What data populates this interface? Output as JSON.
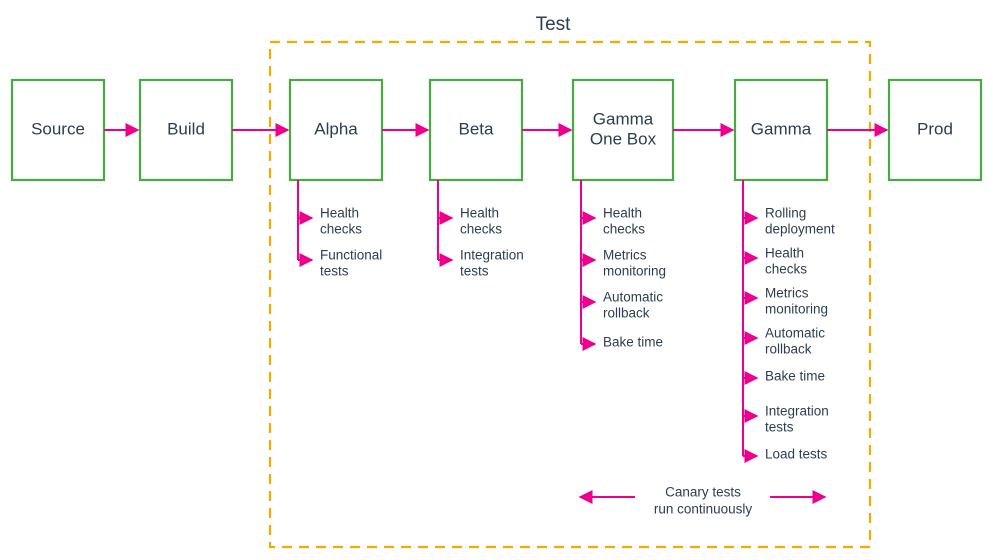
{
  "title": "Test",
  "stages": {
    "source": {
      "label": "Source"
    },
    "build": {
      "label": "Build"
    },
    "alpha": {
      "label": "Alpha"
    },
    "beta": {
      "label": "Beta"
    },
    "gamma_onebox": {
      "label_line1": "Gamma",
      "label_line2": "One Box"
    },
    "gamma": {
      "label": "Gamma"
    },
    "prod": {
      "label": "Prod"
    }
  },
  "sub": {
    "alpha": [
      {
        "l1": "Health",
        "l2": "checks"
      },
      {
        "l1": "Functional",
        "l2": "tests"
      }
    ],
    "beta": [
      {
        "l1": "Health",
        "l2": "checks"
      },
      {
        "l1": "Integration",
        "l2": "tests"
      }
    ],
    "gamma_onebox": [
      {
        "l1": "Health",
        "l2": "checks"
      },
      {
        "l1": "Metrics",
        "l2": "monitoring"
      },
      {
        "l1": "Automatic",
        "l2": "rollback"
      },
      {
        "l1": "Bake time",
        "l2": ""
      }
    ],
    "gamma": [
      {
        "l1": "Rolling",
        "l2": "deployment"
      },
      {
        "l1": "Health",
        "l2": "checks"
      },
      {
        "l1": "Metrics",
        "l2": "monitoring"
      },
      {
        "l1": "Automatic",
        "l2": "rollback"
      },
      {
        "l1": "Bake time",
        "l2": ""
      },
      {
        "l1": "Integration",
        "l2": "tests"
      },
      {
        "l1": "Load tests",
        "l2": ""
      }
    ]
  },
  "footnote": {
    "l1": "Canary tests",
    "l2": "run continuously"
  }
}
